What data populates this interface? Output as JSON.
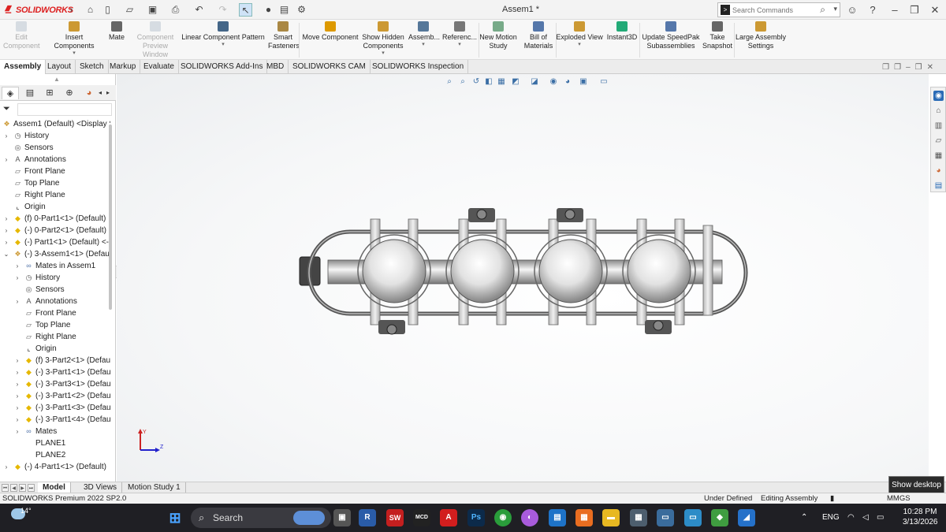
{
  "app": {
    "logo_text": "SOLIDWORKS",
    "doc_title": "Assem1 *"
  },
  "search": {
    "placeholder": "Search Commands"
  },
  "ribbon": [
    {
      "label": "Edit\nComponent",
      "disabled": true
    },
    {
      "label": "Insert Components",
      "disabled": false
    },
    {
      "label": "Mate",
      "disabled": false
    },
    {
      "label": "Component\nPreview Window",
      "disabled": true
    },
    {
      "label": "Linear Component Pattern",
      "disabled": false
    },
    {
      "label": "Smart\nFasteners",
      "disabled": false
    },
    {
      "label": "Move Component",
      "disabled": false
    },
    {
      "label": "Show Hidden\nComponents",
      "disabled": false
    },
    {
      "label": "Assemb...",
      "disabled": false
    },
    {
      "label": "Referenc...",
      "disabled": false
    },
    {
      "label": "New Motion\nStudy",
      "disabled": false
    },
    {
      "label": "Bill of\nMaterials",
      "disabled": false
    },
    {
      "label": "Exploded View",
      "disabled": false
    },
    {
      "label": "Instant3D",
      "disabled": false
    },
    {
      "label": "Update SpeedPak\nSubassemblies",
      "disabled": false
    },
    {
      "label": "Take\nSnapshot",
      "disabled": false
    },
    {
      "label": "Large Assembly\nSettings",
      "disabled": false
    }
  ],
  "tabs": [
    "Assembly",
    "Layout",
    "Sketch",
    "Markup",
    "Evaluate",
    "SOLIDWORKS Add-Ins",
    "MBD",
    "SOLIDWORKS CAM",
    "SOLIDWORKS Inspection"
  ],
  "tree": [
    {
      "label": "Assem1 (Default) <Display S",
      "level": 0,
      "icon": "assembly-icon",
      "expander": ""
    },
    {
      "label": "History",
      "level": 1,
      "icon": "history-icon",
      "expander": "›"
    },
    {
      "label": "Sensors",
      "level": 1,
      "icon": "sensor-icon",
      "expander": ""
    },
    {
      "label": "Annotations",
      "level": 1,
      "icon": "annotation-icon",
      "expander": "›"
    },
    {
      "label": "Front Plane",
      "level": 1,
      "icon": "plane-icon",
      "expander": ""
    },
    {
      "label": "Top Plane",
      "level": 1,
      "icon": "plane-icon",
      "expander": ""
    },
    {
      "label": "Right Plane",
      "level": 1,
      "icon": "plane-icon",
      "expander": ""
    },
    {
      "label": "Origin",
      "level": 1,
      "icon": "origin-icon",
      "expander": ""
    },
    {
      "label": "(f) 0-Part1<1> (Default)",
      "level": 1,
      "icon": "part-icon",
      "expander": "›"
    },
    {
      "label": "(-) 0-Part2<1> (Default)",
      "level": 1,
      "icon": "part-icon",
      "expander": "›"
    },
    {
      "label": "(-) Part1<1> (Default) <-",
      "level": 1,
      "icon": "part-icon",
      "expander": "›"
    },
    {
      "label": "(-) 3-Assem1<1> (Defau",
      "level": 1,
      "icon": "assembly-icon",
      "expander": "⌄"
    },
    {
      "label": "Mates in Assem1",
      "level": 2,
      "icon": "mates-icon",
      "expander": "›"
    },
    {
      "label": "History",
      "level": 2,
      "icon": "history-icon",
      "expander": "›"
    },
    {
      "label": "Sensors",
      "level": 2,
      "icon": "sensor-icon",
      "expander": ""
    },
    {
      "label": "Annotations",
      "level": 2,
      "icon": "annotation-icon",
      "expander": "›"
    },
    {
      "label": "Front Plane",
      "level": 2,
      "icon": "plane-icon",
      "expander": ""
    },
    {
      "label": "Top Plane",
      "level": 2,
      "icon": "plane-icon",
      "expander": ""
    },
    {
      "label": "Right Plane",
      "level": 2,
      "icon": "plane-icon",
      "expander": ""
    },
    {
      "label": "Origin",
      "level": 2,
      "icon": "origin-icon",
      "expander": ""
    },
    {
      "label": "(f) 3-Part2<1> (Defaul",
      "level": 2,
      "icon": "part-icon",
      "expander": "›"
    },
    {
      "label": "(-) 3-Part1<1> (Defau",
      "level": 2,
      "icon": "part-icon",
      "expander": "›"
    },
    {
      "label": "(-) 3-Part3<1> (Defau",
      "level": 2,
      "icon": "part-icon",
      "expander": "›"
    },
    {
      "label": "(-) 3-Part1<2> (Defau",
      "level": 2,
      "icon": "part-icon",
      "expander": "›"
    },
    {
      "label": "(-) 3-Part1<3> (Defau",
      "level": 2,
      "icon": "part-icon",
      "expander": "›"
    },
    {
      "label": "(-) 3-Part1<4> (Defau",
      "level": 2,
      "icon": "part-icon",
      "expander": "›"
    },
    {
      "label": "Mates",
      "level": 2,
      "icon": "mates-icon",
      "expander": "›"
    },
    {
      "label": "PLANE1",
      "level": 2,
      "icon": "",
      "expander": ""
    },
    {
      "label": "PLANE2",
      "level": 2,
      "icon": "",
      "expander": ""
    },
    {
      "label": "(-) 4-Part1<1> (Default)",
      "level": 1,
      "icon": "part-icon",
      "expander": "›"
    }
  ],
  "triad": {
    "y_label": "Y",
    "z_label": "Z"
  },
  "bottom_tabs": [
    "Model",
    "3D Views",
    "Motion Study 1"
  ],
  "tooltip": "Show desktop",
  "status": {
    "version": "SOLIDWORKS Premium 2022 SP2.0",
    "state": "Under Defined",
    "mode": "Editing Assembly",
    "units": "MMGS"
  },
  "taskbar": {
    "temperature": "14°",
    "search": "Search",
    "language": "ENG",
    "time": "10:28 PM",
    "date": "3/13/2026",
    "app_labels": {
      "revit": "R",
      "solidworks": "SW",
      "mcd": "MCD",
      "photoshop": "Ps"
    }
  },
  "colors": {
    "accent": "#d22323",
    "part": "#e6b800",
    "plane": "#7a7a7a",
    "taskbar": "#1f1f24"
  }
}
